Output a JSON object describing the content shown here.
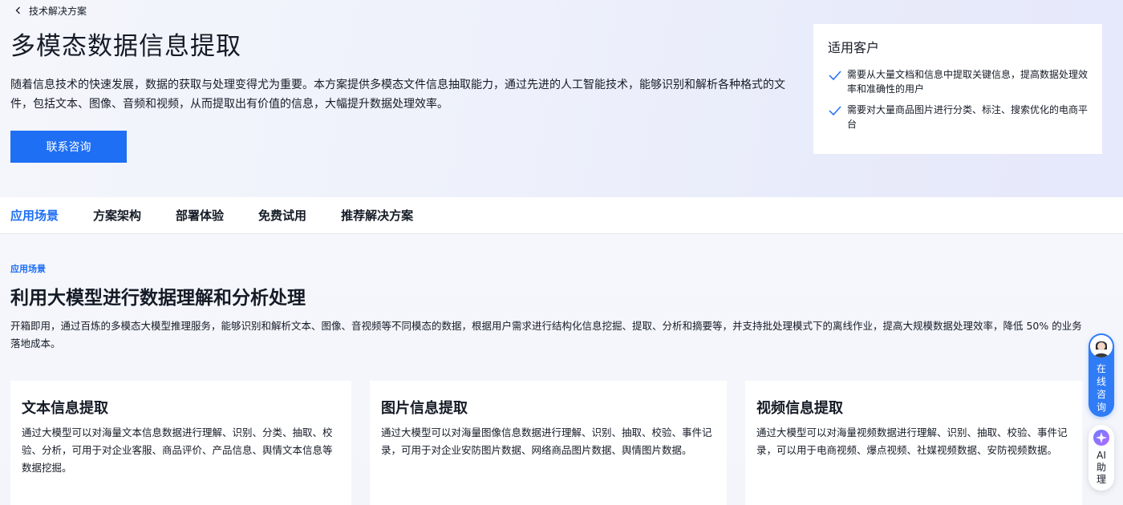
{
  "breadcrumb": {
    "label": "技术解决方案"
  },
  "hero": {
    "title": "多模态数据信息提取",
    "description": "随着信息技术的快速发展，数据的获取与处理变得尤为重要。本方案提供多模态文件信息抽取能力，通过先进的人工智能技术，能够识别和解析各种格式的文件，包括文本、图像、音频和视频，从而提取出有价值的信息，大幅提升数据处理效率。",
    "cta_label": "联系咨询"
  },
  "customers": {
    "title": "适用客户",
    "items": [
      {
        "text": "需要从大量文档和信息中提取关键信息，提高数据处理效率和准确性的用户",
        "icon": "check-icon"
      },
      {
        "text": "需要对大量商品图片进行分类、标注、搜索优化的电商平台",
        "icon": "check-icon"
      }
    ]
  },
  "tabs": [
    {
      "label": "应用场景",
      "active": true
    },
    {
      "label": "方案架构",
      "active": false
    },
    {
      "label": "部署体验",
      "active": false
    },
    {
      "label": "免费试用",
      "active": false
    },
    {
      "label": "推荐解决方案",
      "active": false
    }
  ],
  "section": {
    "kicker": "应用场景",
    "title": "利用大模型进行数据理解和分析处理",
    "description": "开箱即用，通过百炼的多模态大模型推理服务，能够识别和解析文本、图像、音视频等不同模态的数据，根据用户需求进行结构化信息挖掘、提取、分析和摘要等，并支持批处理模式下的离线作业，提高大规模数据处理效率，降低 50% 的业务落地成本。",
    "cards": [
      {
        "title": "文本信息提取",
        "description": "通过大模型可以对海量文本信息数据进行理解、识别、分类、抽取、校验、分析，可用于对企业客服、商品评价、产品信息、舆情文本信息等数据挖掘。"
      },
      {
        "title": "图片信息提取",
        "description": "通过大模型可以对海量图像信息数据进行理解、识别、抽取、校验、事件记录，可用于对企业安防图片数据、网络商品图片数据、舆情图片数据。"
      },
      {
        "title": "视频信息提取",
        "description": "通过大模型可以对海量视频数据进行理解、识别、抽取、校验、事件记录，可以用于电商视频、爆点视频、社媒视频数据、安防视频数据。"
      }
    ]
  },
  "floating": {
    "consult_label": "在线咨询",
    "ai_label": "AI助理"
  },
  "colors": {
    "accent": "#1f6ff4",
    "text": "#151b26"
  }
}
